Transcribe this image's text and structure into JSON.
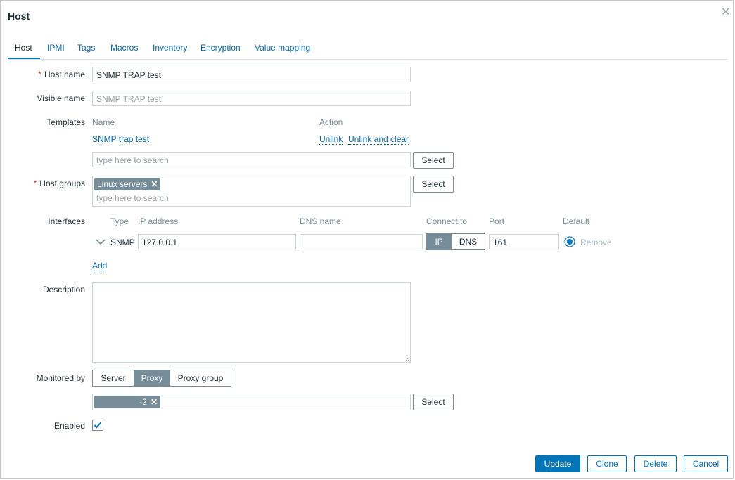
{
  "dialog": {
    "title": "Host",
    "close_glyph": "✕"
  },
  "tabs": [
    "Host",
    "IPMI",
    "Tags",
    "Macros",
    "Inventory",
    "Encryption",
    "Value mapping"
  ],
  "host_name": {
    "label": "Host name",
    "value": "SNMP TRAP test"
  },
  "visible_name": {
    "label": "Visible name",
    "placeholder": "SNMP TRAP test"
  },
  "templates": {
    "label": "Templates",
    "col_name": "Name",
    "col_action": "Action",
    "items": [
      {
        "name": "SNMP trap test",
        "unlink": "Unlink",
        "unlink_clear": "Unlink and clear"
      }
    ],
    "search_placeholder": "type here to search",
    "select": "Select"
  },
  "host_groups": {
    "label": "Host groups",
    "chips": [
      "Linux servers"
    ],
    "search_placeholder": "type here to search",
    "select": "Select"
  },
  "interfaces": {
    "label": "Interfaces",
    "headers": {
      "type": "Type",
      "ip": "IP address",
      "dns": "DNS name",
      "connect": "Connect to",
      "port": "Port",
      "default": "Default"
    },
    "rows": [
      {
        "type": "SNMP",
        "ip": "127.0.0.1",
        "dns": "",
        "connect_ip": "IP",
        "connect_dns": "DNS",
        "port": "161",
        "remove": "Remove"
      }
    ],
    "add": "Add"
  },
  "description": {
    "label": "Description",
    "value": ""
  },
  "monitored_by": {
    "label": "Monitored by",
    "options": [
      "Server",
      "Proxy",
      "Proxy group"
    ],
    "selected": "Proxy",
    "proxy_chip": "-2",
    "select": "Select"
  },
  "enabled": {
    "label": "Enabled",
    "checked": true
  },
  "footer": {
    "update": "Update",
    "clone": "Clone",
    "delete": "Delete",
    "cancel": "Cancel"
  },
  "colors": {
    "accent": "#0275b8",
    "link": "#0a66a6",
    "chip": "#768d99",
    "required": "#e33734"
  }
}
